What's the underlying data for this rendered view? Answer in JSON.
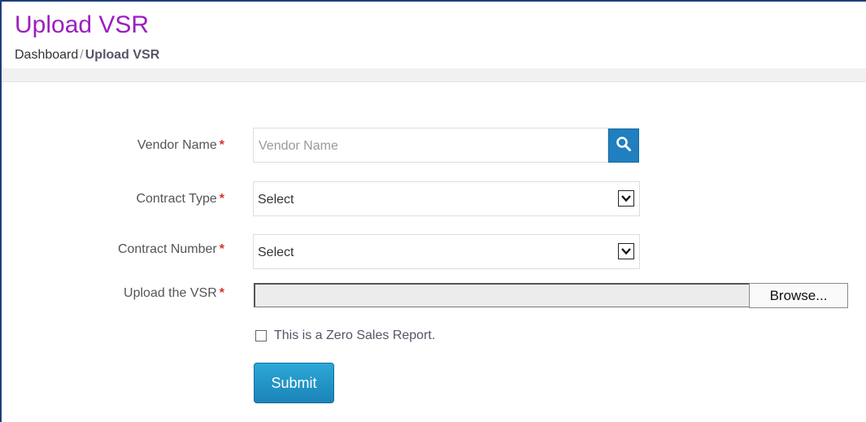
{
  "header": {
    "title": "Upload VSR",
    "breadcrumb": {
      "home": "Dashboard",
      "separator": "/",
      "current": "Upload VSR"
    }
  },
  "form": {
    "vendor_name": {
      "label": "Vendor Name",
      "required_mark": "*",
      "placeholder": "Vendor Name",
      "value": ""
    },
    "contract_type": {
      "label": "Contract Type",
      "required_mark": "*",
      "selected": "Select"
    },
    "contract_number": {
      "label": "Contract Number",
      "required_mark": "*",
      "selected": "Select"
    },
    "upload": {
      "label": "Upload the VSR",
      "required_mark": "*",
      "browse_label": "Browse..."
    },
    "zero_sales": {
      "label": "This is a Zero Sales Report.",
      "checked": false
    },
    "submit_label": "Submit"
  },
  "icons": {
    "search": "search-icon",
    "dropdown": "chevron-down-icon"
  },
  "colors": {
    "title": "#9b1fbf",
    "required": "#d9322b",
    "primary_button": "#1a83b8",
    "search_button": "#1f7fbf"
  }
}
